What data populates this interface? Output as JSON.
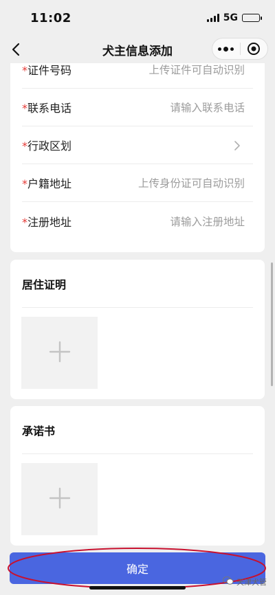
{
  "status_bar": {
    "time": "11:02",
    "network": "5G",
    "battery_level": 0.55
  },
  "nav": {
    "title": "犬主信息添加",
    "more_icon": "more-dots-icon",
    "close_icon": "target-circle-icon"
  },
  "form": {
    "rows": [
      {
        "required": "*",
        "label": "证件号码",
        "placeholder": "上传证件可自动识别"
      },
      {
        "required": "*",
        "label": "联系电话",
        "placeholder": "请输入联系电话"
      },
      {
        "required": "*",
        "label": "行政区划",
        "placeholder": ""
      },
      {
        "required": "*",
        "label": "户籍地址",
        "placeholder": "上传身份证可自动识别"
      },
      {
        "required": "*",
        "label": "注册地址",
        "placeholder": "请输入注册地址"
      }
    ]
  },
  "residence_proof": {
    "title": "居住证明"
  },
  "commitment_letter": {
    "title": "承诺书"
  },
  "confirm": {
    "label": "确定"
  },
  "watermark": {
    "text": "天津犬管"
  },
  "colors": {
    "accent": "#4a66e0",
    "required": "#e53935",
    "annotation": "#c8102e"
  }
}
